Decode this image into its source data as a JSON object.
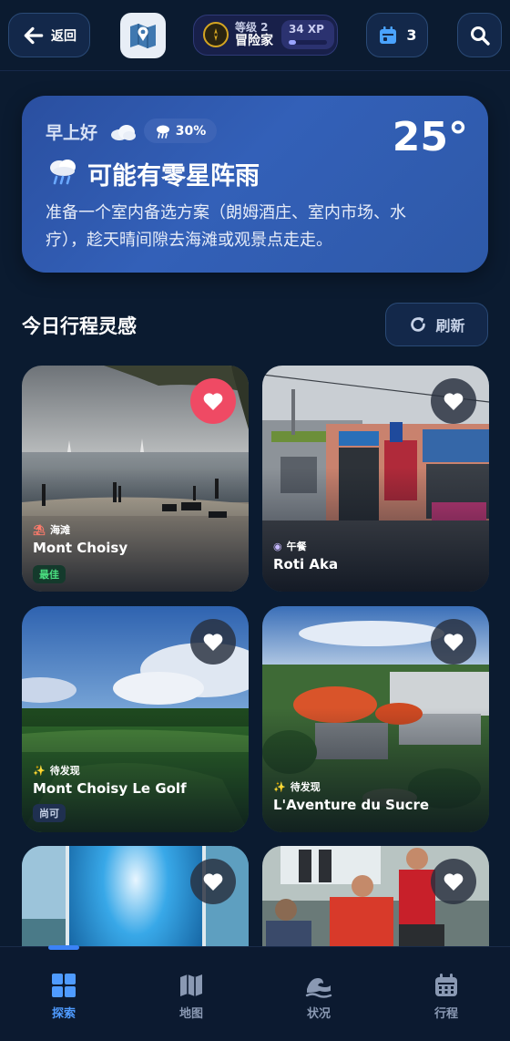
{
  "header": {
    "back_label": "返回",
    "level_label": "等级 2",
    "rank_label": "冒险家",
    "xp_label": "34 XP",
    "xp_progress": 0.2,
    "calendar_count": "3"
  },
  "weather": {
    "greeting": "早上好",
    "rain_chance": "30%",
    "temperature": "25°",
    "condition": "可能有零星阵雨",
    "tip": "准备一个室内备选方案（朗姆酒庄、室内市场、水疗），趁天晴间隙去海滩或观景点走走。"
  },
  "section": {
    "title": "今日行程灵感",
    "refresh_label": "刷新"
  },
  "cards": [
    {
      "category": "海滩",
      "category_icon": "beach-umbrella-icon",
      "name": "Mont Choisy",
      "badge": "最佳",
      "liked": true
    },
    {
      "category": "午餐",
      "category_icon": "food-icon",
      "name": "Roti Aka",
      "badge": "",
      "liked": false
    },
    {
      "category": "待发现",
      "category_icon": "sparkle-icon",
      "name": "Mont Choisy Le Golf",
      "badge": "尚可",
      "liked": false
    },
    {
      "category": "待发现",
      "category_icon": "sparkle-icon",
      "name": "L'Aventure du Sucre",
      "badge": "",
      "liked": false
    },
    {
      "category": "",
      "name": "",
      "badge": "",
      "liked": false
    },
    {
      "category": "",
      "name": "",
      "badge": "",
      "liked": false
    }
  ],
  "nav": {
    "items": [
      {
        "label": "探索",
        "icon": "grid-icon",
        "active": true
      },
      {
        "label": "地图",
        "icon": "map-icon",
        "active": false
      },
      {
        "label": "状况",
        "icon": "wave-icon",
        "active": false
      },
      {
        "label": "行程",
        "icon": "calendar-icon",
        "active": false
      }
    ]
  },
  "colors": {
    "background": "#0b1b30",
    "accent": "#3b82f6",
    "liked": "#ef4a64",
    "badge_best": "#4ade80"
  }
}
